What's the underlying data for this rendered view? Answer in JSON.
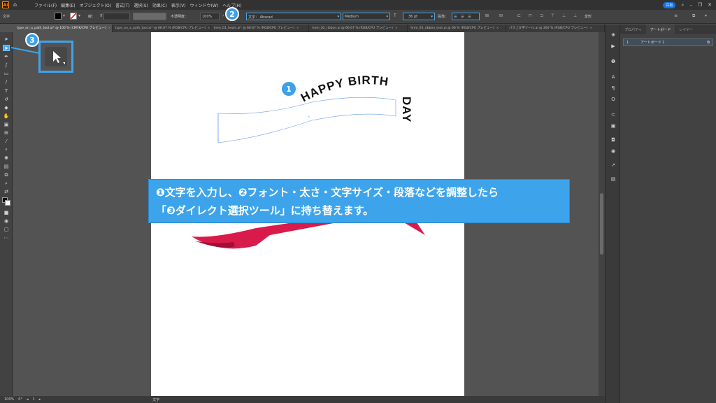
{
  "menubar": {
    "logo": "Ai",
    "menus": [
      "ファイル(F)",
      "編集(E)",
      "オブジェクト(O)",
      "書式(T)",
      "選択(S)",
      "効果(C)",
      "表示(V)",
      "ウィンドウ(W)",
      "ヘルプ(H)"
    ],
    "share_label": "共有"
  },
  "controlbar": {
    "mode_label": "文字",
    "stroke_label": "線：",
    "opacity_label": "不透明度：",
    "opacity_value": "100%",
    "font_label": "文字：",
    "font_name": "Abscad",
    "font_style": "Medium",
    "font_size": "36 pt",
    "paragraph_label": "段落：",
    "transform_label": "変形"
  },
  "badges": {
    "one": "1",
    "two": "2",
    "three": "3"
  },
  "tabs": [
    {
      "label": "type_on_a_path_tool.ai* @ 100 % (CMYK/CPU プレビュー)",
      "active": true
    },
    {
      "label": "type_on_a_path_tool.ai* @ 66.67 % (RGB/CPU プレビュー)",
      "active": false
    },
    {
      "label": "hnm_01_heart.ai* @ 66.67 % (RGB/CPU プレビュー)",
      "active": false
    },
    {
      "label": "hnm_02_ribbon.ai @ 66.67 % (RGB/CPU プレビュー)",
      "active": false
    },
    {
      "label": "hnm_03_ribbon_text.ai @ 66 % (RGB/CPU プレビュー)",
      "active": false
    },
    {
      "label": "パス上文字ツール.ai @ 200 % (RGB/CPU プレビュー)",
      "active": false
    }
  ],
  "artwork": {
    "arc_text": "HAPPY BIRTH",
    "vertical_text": "DAY",
    "ribbon_color": "#d81b4a",
    "ribbon_dark": "#a30f34"
  },
  "callout": {
    "line1_num": "❶",
    "line1_a": "文字を入力し、",
    "line1_num2": "❷",
    "line1_b": "フォント・太さ・文字サイズ・段落などを調整したら",
    "line2_a": "「",
    "line2_num": "❸",
    "line2_b": "ダイレクト選択ツール」に持ち替えます。"
  },
  "panel": {
    "tabs": [
      "プロパティ",
      "アートボード",
      "レイヤー"
    ],
    "active_tab": "アートボード",
    "row_num": "1",
    "row_name": "アートボード 1"
  },
  "statusbar": {
    "zoom": "100%",
    "rotation": "0°",
    "page": "1",
    "tool_label": "文字"
  },
  "colors": {
    "accent": "#3da4ec",
    "selection": "#3fa8f5",
    "ui_dark": "#424242",
    "canvas": "#535353"
  }
}
